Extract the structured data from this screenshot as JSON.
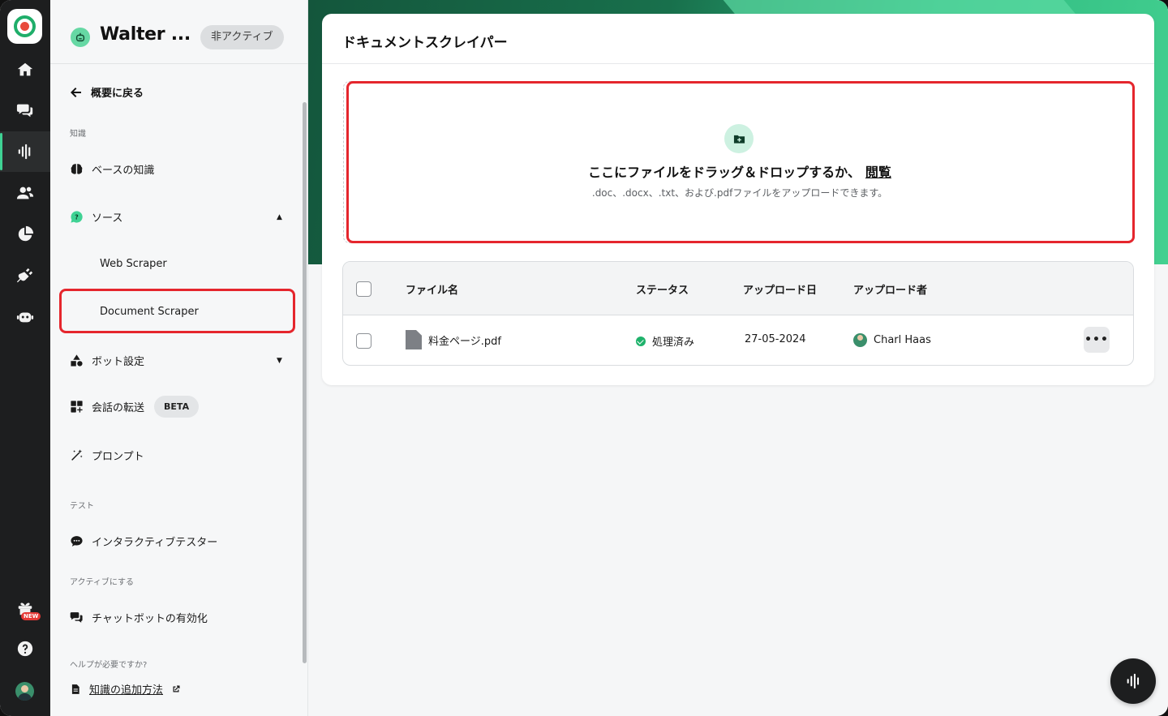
{
  "colors": {
    "accent": "#3fd294",
    "highlight": "#e5262d",
    "rail_bg": "#1d1e1f",
    "success": "#1fb26b"
  },
  "rail": {
    "items": [
      {
        "icon": "home-icon"
      },
      {
        "icon": "chat-bubbles-icon"
      },
      {
        "icon": "soundwave-icon",
        "active": true
      },
      {
        "icon": "users-icon"
      },
      {
        "icon": "pie-chart-icon"
      },
      {
        "icon": "plug-icon"
      },
      {
        "icon": "robot-icon"
      }
    ],
    "new_badge": "NEW"
  },
  "sidebar": {
    "bot_name": "Walter ...",
    "status_pill": "非アクティブ",
    "back_label": "概要に戻る",
    "section_knowledge": "知識",
    "knowledge_base": "ベースの知識",
    "sources": "ソース",
    "web_scraper": "Web Scraper",
    "document_scraper": "Document Scraper",
    "bot_settings": "ボット設定",
    "conversation_forward": "会話の転送",
    "beta": "BETA",
    "prompt": "プロンプト",
    "section_test": "テスト",
    "interactive_tester": "インタラクティブテスター",
    "section_activate": "アクティブにする",
    "enable_chatbot": "チャットボットの有効化",
    "section_help": "ヘルプが必要ですか?",
    "help_link": "知識の追加方法"
  },
  "main": {
    "title": "ドキュメントスクレイパー",
    "dropzone": {
      "title": "ここにファイルをドラッグ＆ドロップするか、",
      "browse": "閲覧",
      "subtitle": ".doc、.docx、.txt、および.pdfファイルをアップロードできます。"
    },
    "table": {
      "headers": [
        "ファイル名",
        "ステータス",
        "アップロード日",
        "アップロード者"
      ],
      "rows": [
        {
          "file": "料金ページ.pdf",
          "status": "処理済み",
          "date": "27-05-2024",
          "uploader": "Charl Haas"
        }
      ],
      "more": "•••"
    }
  }
}
